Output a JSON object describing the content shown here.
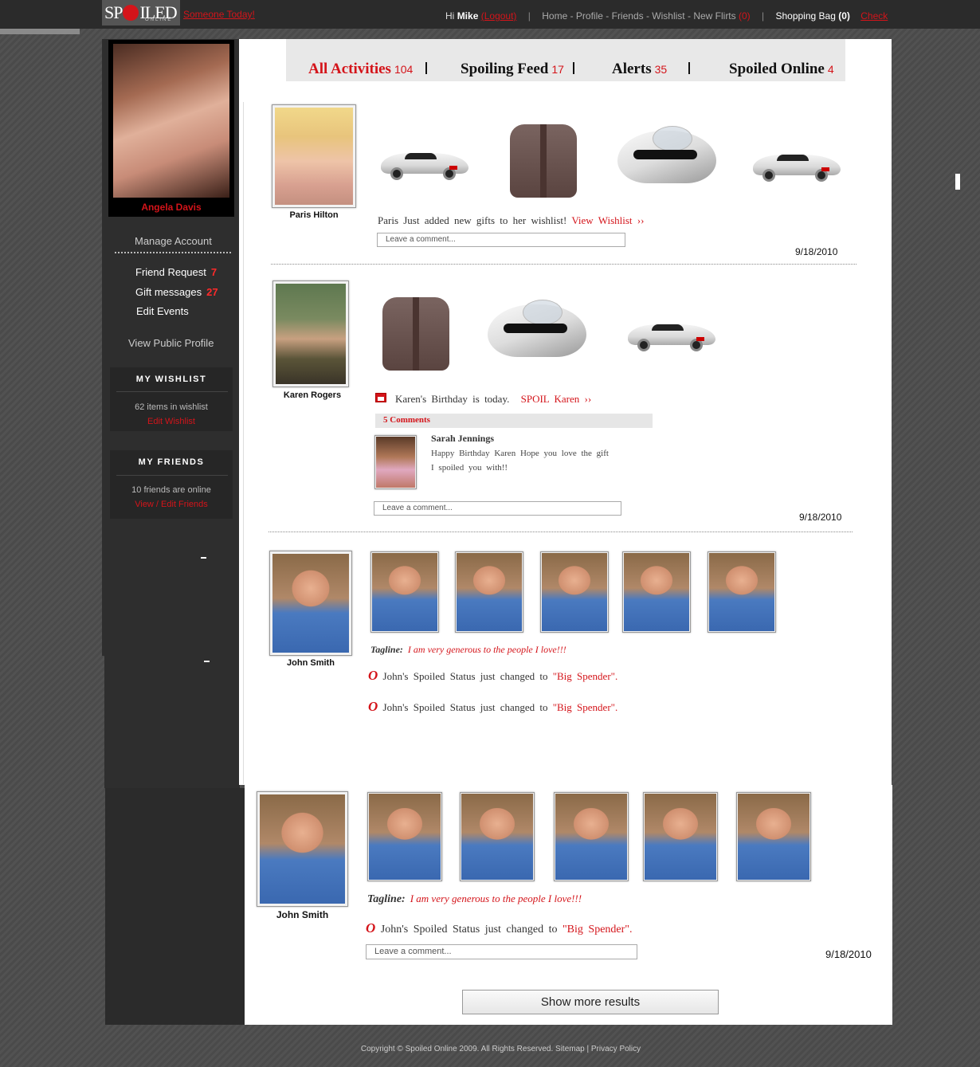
{
  "header": {
    "logo_text": "SPOILED",
    "logo_sub": "ONLINE",
    "tagline": "Someone Today!",
    "greeting": "Hi",
    "username": "Mike",
    "logout": "(Logout)",
    "nav": [
      "Home",
      "Profile",
      "Friends",
      "Wishlist",
      "New Flirts"
    ],
    "new_flirts_count": "(0)",
    "shopping_bag": "Shopping Bag",
    "bag_count": "(0)",
    "checkout": "Check"
  },
  "sidebar": {
    "profile_name": "Angela Davis",
    "manage_account": "Manage Account",
    "friend_request": "Friend Request",
    "friend_request_count": "7",
    "gift_messages": "Gift messages",
    "gift_messages_count": "27",
    "edit_events": "Edit Events",
    "view_public_profile": "View Public Profile",
    "wishlist_header": "MY WISHLIST",
    "wishlist_count_text": "62 items in wishlist",
    "edit_wishlist": "Edit Wishlist",
    "friends_header": "MY FRIENDS",
    "friends_online_text": "10 friends are online",
    "view_edit_friends": "View / Edit Friends"
  },
  "tabs": [
    {
      "label": "All Activities",
      "count": "104"
    },
    {
      "label": "Spoiling Feed",
      "count": "17"
    },
    {
      "label": "Alerts",
      "count": "35"
    },
    {
      "label": "Spoiled Online",
      "count": "4"
    }
  ],
  "feed": {
    "item1": {
      "name": "Paris Hilton",
      "text": "Paris Just added new gifts to her wishlist!",
      "link": "View Wishlist",
      "arrows": "››",
      "comment_placeholder": "Leave a comment...",
      "date": "9/18/2010"
    },
    "item2": {
      "name": "Karen Rogers",
      "text": "Karen's Birthday is today.",
      "link": "SPOIL Karen",
      "arrows": "››",
      "comments_count": "5 Comments",
      "commenter": "Sarah Jennings",
      "comment_line1": "Happy Birthday Karen Hope you love the gift",
      "comment_line2": "I spoiled you with!!",
      "comment_placeholder": "Leave a comment...",
      "date": "9/18/2010"
    },
    "item3": {
      "name": "John Smith",
      "tagline_label": "Tagline:",
      "tagline": "I am very generous to the people I love!!!",
      "status_icon": "O",
      "status_prefix": "John's Spoiled Status just changed to",
      "status_value": "\"Big Spender\".",
      "status_prefix_2": "John's Spoiled Status just changed to",
      "status_value_2": "\"Big Spender\"."
    },
    "item4": {
      "name": "John Smith",
      "tagline_label": "Tagline:",
      "tagline": "I am very generous to the people I love!!!",
      "status_icon": "O",
      "status_prefix": "John's Spoiled Status just changed to",
      "status_value": "\"Big Spender\".",
      "comment_placeholder": "Leave a comment...",
      "date": "9/18/2010"
    }
  },
  "show_more": "Show more results",
  "footer": {
    "copyright": "Copyright © Spoiled Online 2009. All Rights Reserved.",
    "sitemap": "Sitemap",
    "sep": "|",
    "privacy": "Privacy Policy"
  },
  "colors": {
    "accent": "#d4141a",
    "sidebar": "#2e2e2e",
    "topbar": "#2b2b2b"
  }
}
